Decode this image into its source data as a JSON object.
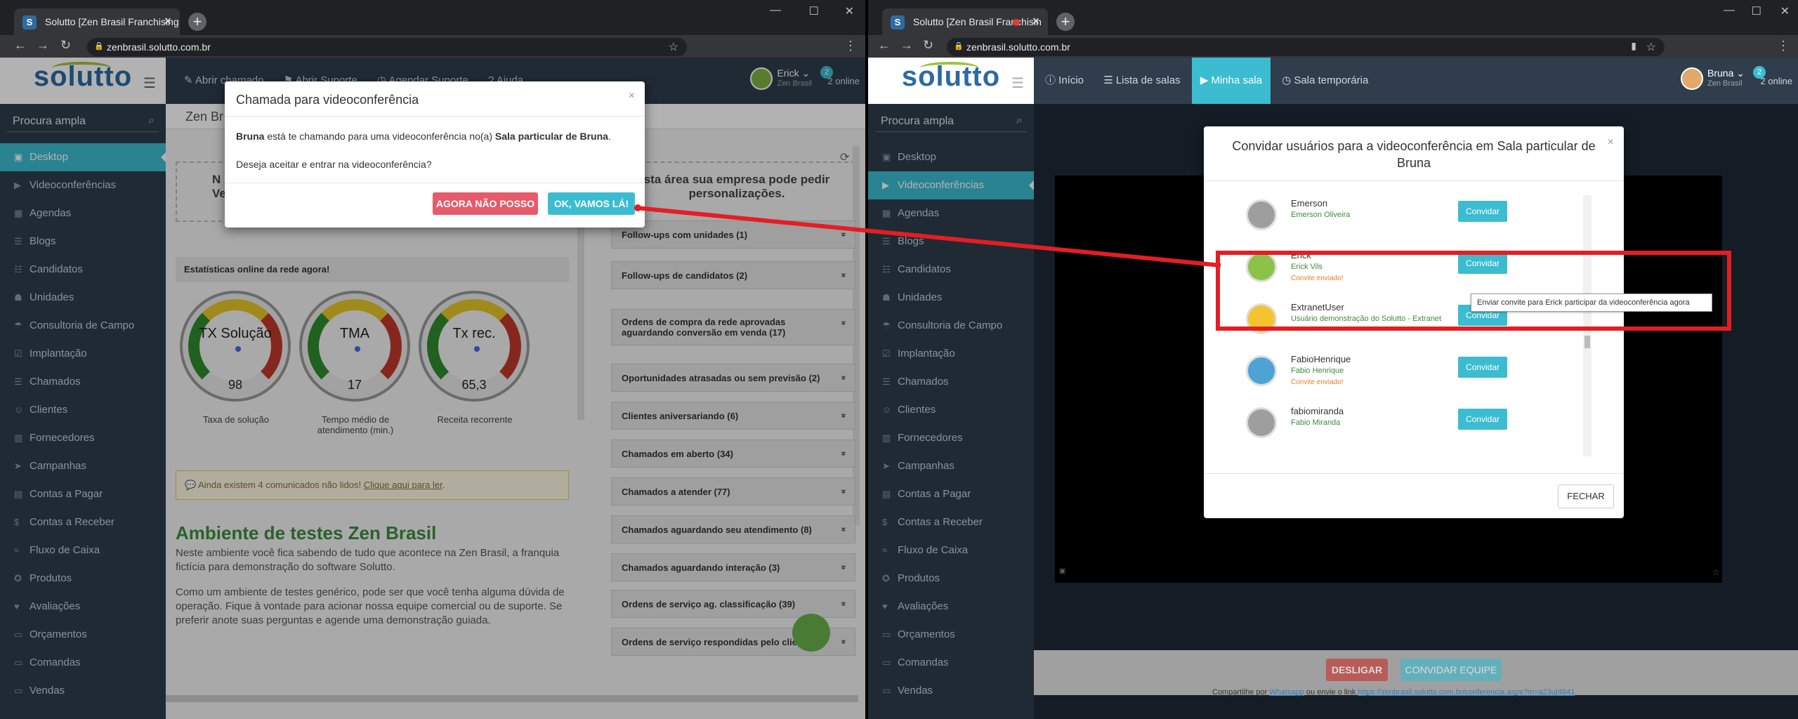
{
  "left": {
    "tab_title": "Solutto [Zen Brasil Franchising",
    "url": "zenbrasil.solutto.com.br",
    "logo": "solutto",
    "nav": {
      "open_call": "Abrir chamado",
      "support": "Abrir Suporte",
      "video": "Agendar Suporte",
      "help": "Ajuda"
    },
    "user": {
      "name": "Erick",
      "org": "Zen Brasil",
      "online_count": "2",
      "online": "2 online"
    },
    "search_placeholder": "Procura ampla",
    "sidebar": [
      "Desktop",
      "Videoconferências",
      "Agendas",
      "Blogs",
      "Candidatos",
      "Unidades",
      "Consultoria de Campo",
      "Implantação",
      "Chamados",
      "Clientes",
      "Fornecedores",
      "Campanhas",
      "Contas a Pagar",
      "Contas a Receber",
      "Fluxo de Caixa",
      "Produtos",
      "Avaliações",
      "Orçamentos",
      "Comandas",
      "Vendas"
    ],
    "breadcrumb": "Zen Br",
    "promo_left": "N\nVeja d",
    "promo_right": "sta área sua empresa pode pedir\npersonalizações.",
    "stats_title": "Estatísticas online da rede agora!",
    "gauges": [
      {
        "title": "TX Solução",
        "value": "98",
        "label": "Taxa de solução"
      },
      {
        "title": "TMA",
        "value": "17",
        "label": "Tempo médio de atendimento (min.)"
      },
      {
        "title": "Tx rec.",
        "value": "65,3",
        "label": "Receita recorrente"
      }
    ],
    "notice": "Ainda existem 4 comunicados não lidos!",
    "notice_link": "Clique aqui para ler",
    "heading": "Ambiente de testes Zen Brasil",
    "para1": "Neste ambiente você fica sabendo de tudo que acontece na Zen Brasil, a franquia fictícia para demonstração do software Solutto.",
    "para2": "Como um ambiente de testes genérico, pode ser que você tenha alguma dúvida de operação. Fique à vontade para acionar nossa equipe comercial ou de suporte. Se preferir anote suas perguntas e agende uma demonstração guiada.",
    "followups": [
      "Follow-ups com unidades (1)",
      "Follow-ups de candidatos (2)",
      "Ordens de compra da rede aprovadas aguardando conversão em venda (17)",
      "Oportunidades atrasadas ou sem previsão (2)",
      "Clientes aniversariando (6)",
      "Chamados em aberto (34)",
      "Chamados a atender (77)",
      "Chamados aguardando seu atendimento (8)",
      "Chamados aguardando interação (3)",
      "Ordens de serviço ag. classificação (39)",
      "Ordens de serviço respondidas pelo cliente"
    ],
    "modal": {
      "title": "Chamada para videoconferência",
      "caller": "Bruna",
      "body_mid": "está te chamando para uma videoconferência no(a)",
      "room": "Sala particular de Bruna",
      "question": "Deseja aceitar e entrar na videoconferência?",
      "decline": "AGORA NÃO POSSO",
      "accept": "OK, VAMOS LÁ!"
    }
  },
  "right": {
    "tab_title": "Solutto [Zen Brasil Franchisin",
    "url": "zenbrasil.solutto.com.br",
    "logo": "solutto",
    "nav": {
      "home": "Início",
      "rooms": "Lista de salas",
      "myroom": "Minha sala",
      "temp": "Sala temporária"
    },
    "user": {
      "name": "Bruna",
      "org": "Zen Brasil",
      "online_count": "2",
      "online": "2 online"
    },
    "search_placeholder": "Procura ampla",
    "sidebar": [
      "Desktop",
      "Videoconferências",
      "Agendas",
      "Blogs",
      "Candidatos",
      "Unidades",
      "Consultoria de Campo",
      "Implantação",
      "Chamados",
      "Clientes",
      "Fornecedores",
      "Campanhas",
      "Contas a Pagar",
      "Contas a Receber",
      "Fluxo de Caixa",
      "Produtos",
      "Avaliações",
      "Orçamentos",
      "Comandas",
      "Vendas"
    ],
    "modal": {
      "title": "Convidar usuários para a videoconferência em Sala particular de Bruna",
      "invite": "Convidar",
      "sent": "Convite enviado!",
      "users": [
        {
          "name": "Emerson",
          "sub": "Emerson Oliveira",
          "sent": false
        },
        {
          "name": "Erick",
          "sub": "Erick Vils",
          "sent": true
        },
        {
          "name": "ExtranetUser",
          "sub": "Usuário demonstração do Solutto - Extranet",
          "sent": false
        },
        {
          "name": "FabioHenrique",
          "sub": "Fabio Henrique",
          "sent": true
        },
        {
          "name": "fabiomiranda",
          "sub": "Fabio Miranda",
          "sent": false
        }
      ],
      "tooltip": "Enviar convite para Erick participar da videoconferência agora",
      "close": "FECHAR"
    },
    "hangup": "DESLIGAR",
    "invite_team": "CONVIDAR EQUIPE",
    "share_prefix": "Compartilhe por",
    "share_whatsapp": "Whatsapp",
    "share_mid": "ou envie o link",
    "share_link": "https://zenbrasil.solutto.com.br/conferencia.aspx?m=a23ut4841"
  },
  "colors": {
    "accent": "#3cbcd0",
    "sidebar": "#2f3d4c",
    "decline": "#e55b6b",
    "annotation": "#e31e24"
  }
}
